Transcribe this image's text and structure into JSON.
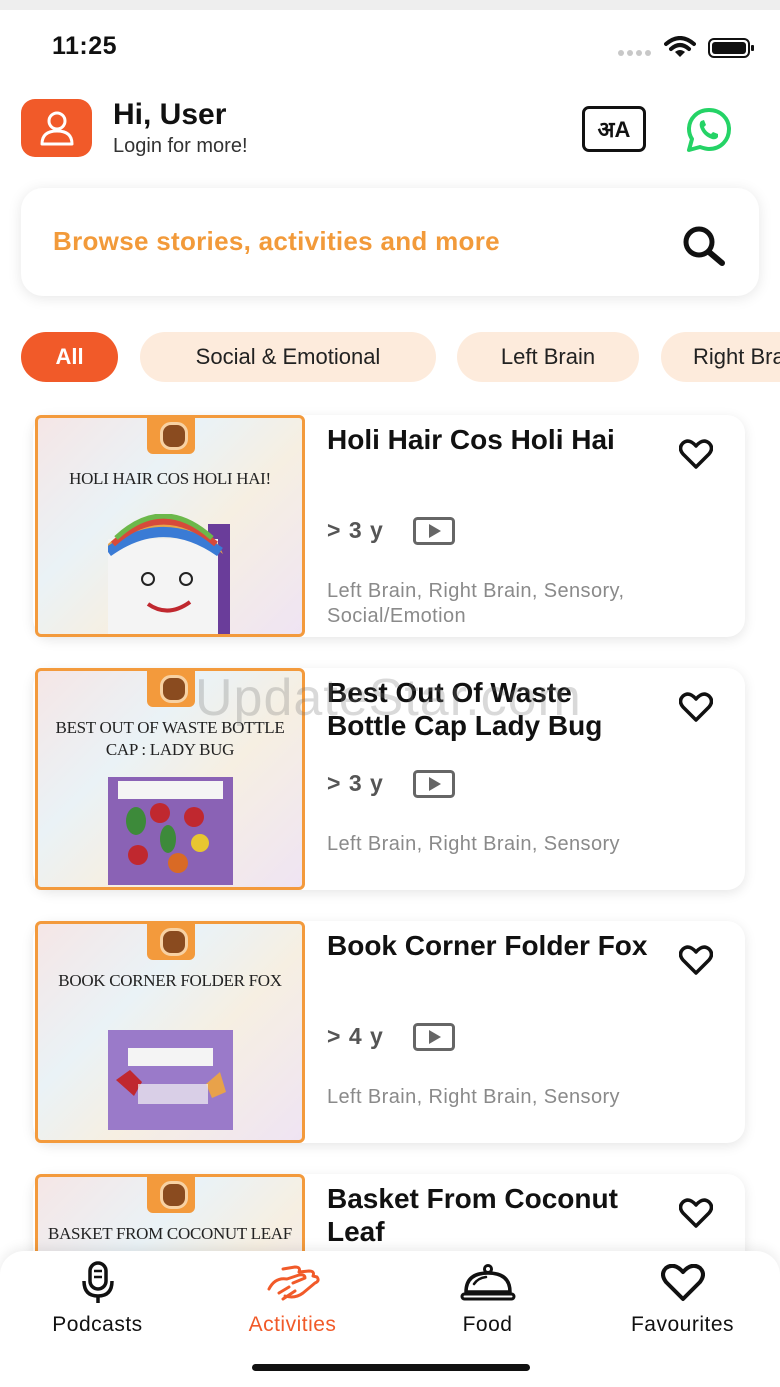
{
  "status_bar": {
    "time": "11:25"
  },
  "header": {
    "greeting": "Hi, User",
    "subtitle": "Login for more!",
    "language_button_label": "अA"
  },
  "search": {
    "placeholder": "Browse stories, activities and more"
  },
  "filters": [
    {
      "label": "All",
      "active": true
    },
    {
      "label": "Social & Emotional",
      "active": false
    },
    {
      "label": "Left Brain",
      "active": false
    },
    {
      "label": "Right Brain",
      "active": false
    }
  ],
  "activities": [
    {
      "thumb_title": "Holi Hair Cos Holi Hai!",
      "title": "Holi Hair Cos Holi Hai",
      "age": "> 3 y",
      "tags": "Left Brain, Right Brain, Sensory, Social/Emotion"
    },
    {
      "thumb_title": "Best Out Of Waste Bottle Cap : Lady Bug",
      "title": "Best Out Of Waste Bottle Cap Lady Bug",
      "age": "> 3 y",
      "tags": "Left Brain, Right Brain, Sensory"
    },
    {
      "thumb_title": "Book Corner Folder Fox",
      "title": "Book Corner Folder Fox",
      "age": "> 4 y",
      "tags": "Left Brain, Right Brain, Sensory"
    },
    {
      "thumb_title": "Basket From Coconut Leaf",
      "title": "Basket From Coconut Leaf",
      "age": "",
      "tags": ""
    }
  ],
  "watermark": "UpdateStar.com",
  "bottom_nav": [
    {
      "label": "Podcasts",
      "icon": "microphone-icon",
      "active": false
    },
    {
      "label": "Activities",
      "icon": "hands-icon",
      "active": true
    },
    {
      "label": "Food",
      "icon": "cloche-icon",
      "active": false
    },
    {
      "label": "Favourites",
      "icon": "heart-icon",
      "active": false
    }
  ],
  "colors": {
    "accent": "#f15a29",
    "chip_bg": "#fdebdc",
    "placeholder": "#f29a3a",
    "thumb_border": "#f39a3c",
    "whatsapp": "#25d366"
  }
}
